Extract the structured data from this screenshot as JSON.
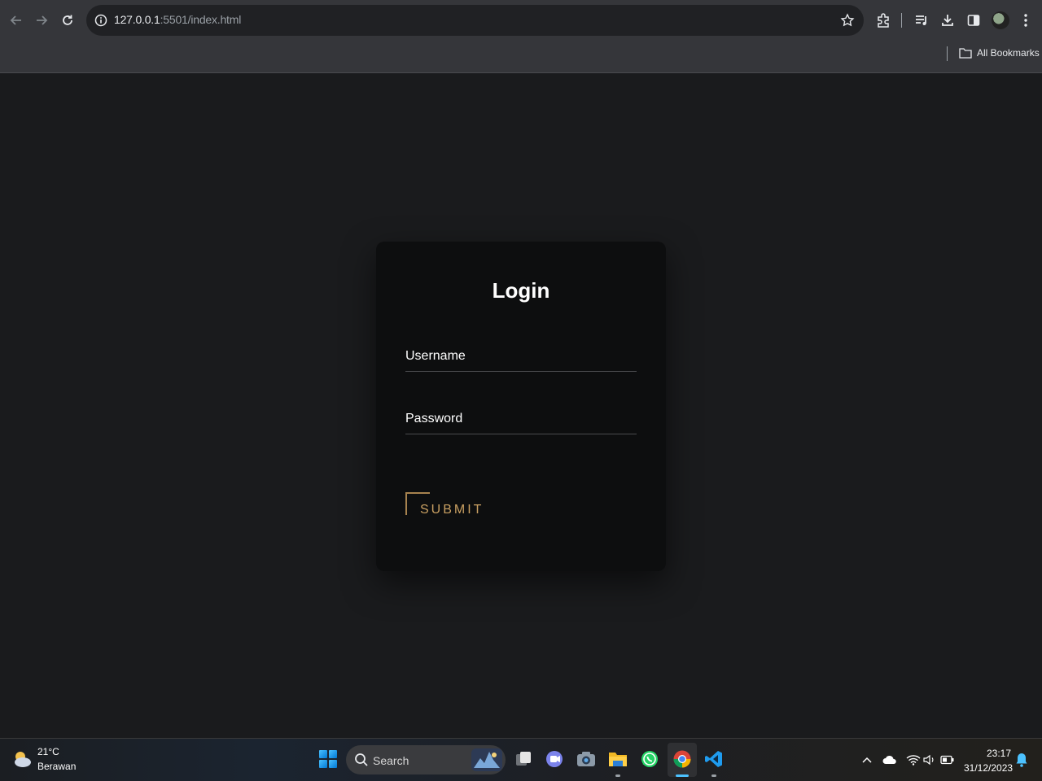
{
  "browser": {
    "url_host": "127.0.0.1",
    "url_rest": ":5501/index.html",
    "all_bookmarks": "All Bookmarks"
  },
  "login": {
    "title": "Login",
    "username_label": "Username",
    "password_label": "Password",
    "submit_label": "SUBMIT",
    "accent_color": "#c9a062"
  },
  "taskbar": {
    "weather_temp": "21°C",
    "weather_desc": "Berawan",
    "search_label": "Search",
    "time": "23:17",
    "date": "31/12/2023"
  }
}
